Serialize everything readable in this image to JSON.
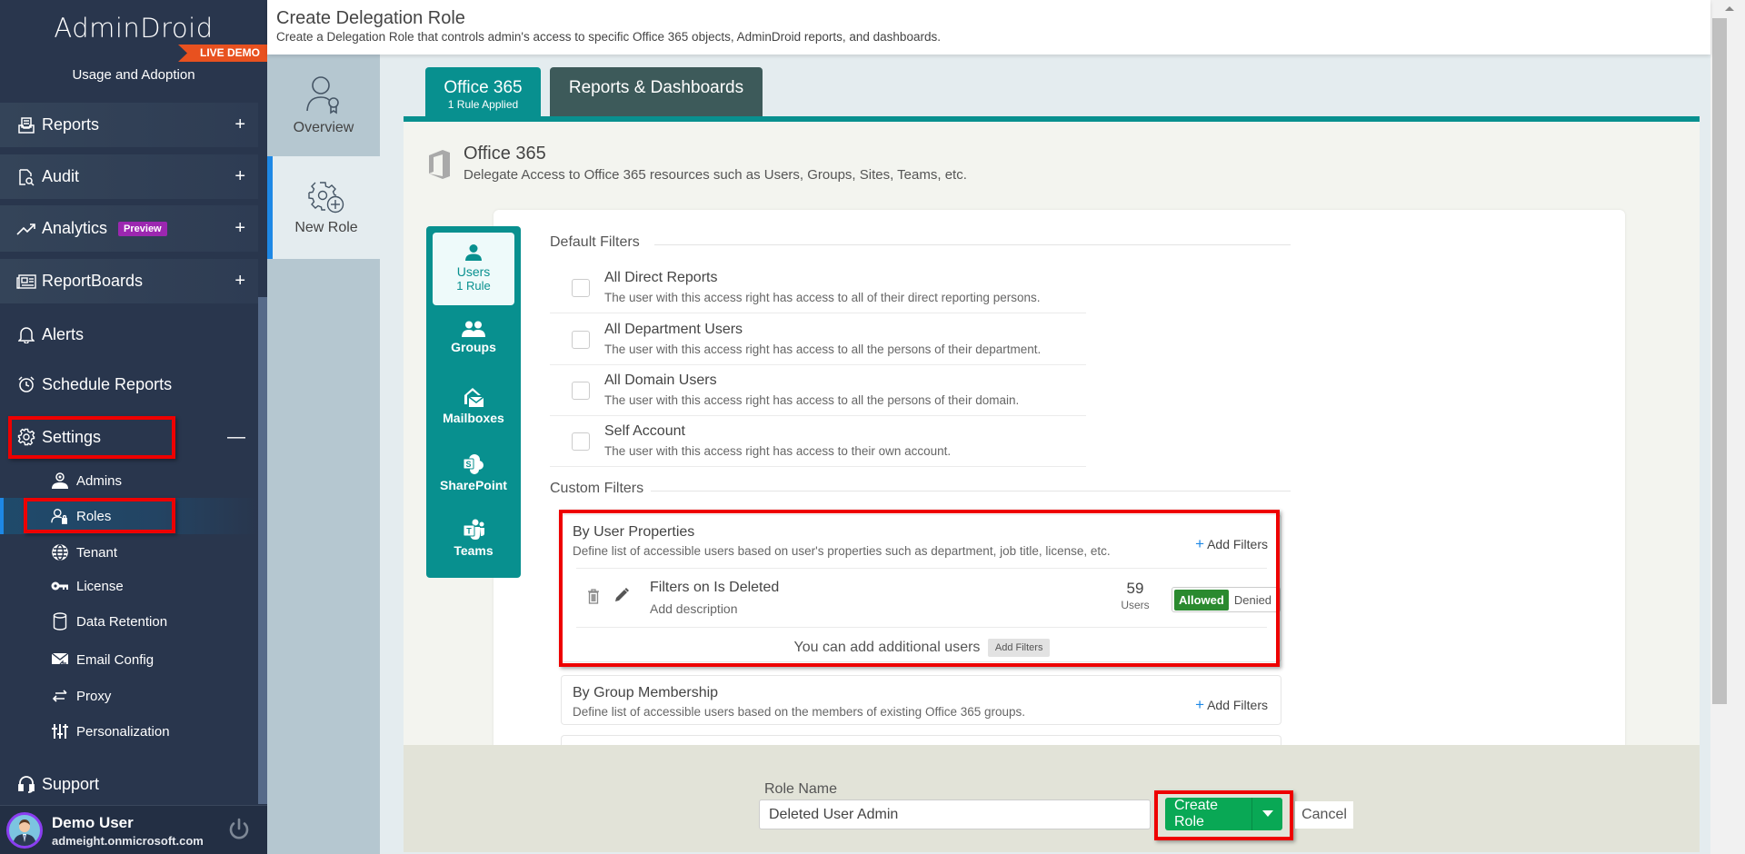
{
  "sidebar": {
    "logo": "AdminDroid",
    "badge": "LIVE DEMO",
    "edition": "Usage and Adoption",
    "groups": [
      {
        "label": "Reports",
        "icon": "reports-icon",
        "expander": "+"
      },
      {
        "label": "Audit",
        "icon": "audit-icon",
        "expander": "+"
      },
      {
        "label": "Analytics",
        "icon": "analytics-icon",
        "badge": "Preview",
        "expander": "+"
      },
      {
        "label": "ReportBoards",
        "icon": "reportboards-icon",
        "expander": "+"
      }
    ],
    "alerts": "Alerts",
    "schedule_reports": "Schedule Reports",
    "settings": {
      "label": "Settings",
      "expander": "—"
    },
    "settings_items": [
      {
        "label": "Admins",
        "icon": "admins-icon"
      },
      {
        "label": "Roles",
        "icon": "roles-icon",
        "active": true
      },
      {
        "label": "Tenant",
        "icon": "globe-icon"
      },
      {
        "label": "License",
        "icon": "key-icon"
      },
      {
        "label": "Data Retention",
        "icon": "database-icon"
      },
      {
        "label": "Email Config",
        "icon": "email-config-icon"
      },
      {
        "label": "Proxy",
        "icon": "proxy-icon"
      },
      {
        "label": "Personalization",
        "icon": "sliders-icon"
      }
    ],
    "support": "Support",
    "user": {
      "name": "Demo User",
      "email": "admeight.onmicrosoft.com"
    }
  },
  "header": {
    "title": "Create Delegation Role",
    "subtitle": "Create a Delegation Role that controls admin's access to specific Office 365 objects, AdminDroid reports, and dashboards."
  },
  "subnav": {
    "items": [
      {
        "label": "Overview"
      },
      {
        "label": "New Role",
        "active": true
      }
    ]
  },
  "tabs": [
    {
      "label": "Office 365",
      "sub": "1 Rule Applied",
      "active": true
    },
    {
      "label": "Reports & Dashboards"
    }
  ],
  "section": {
    "title": "Office 365",
    "description": "Delegate Access to Office 365 resources such as Users, Groups, Sites, Teams, etc."
  },
  "object_tabs": [
    {
      "label": "Users",
      "sub": "1 Rule",
      "active": true
    },
    {
      "label": "Groups"
    },
    {
      "label": "Mailboxes"
    },
    {
      "label": "SharePoint"
    },
    {
      "label": "Teams"
    }
  ],
  "default_filters": {
    "label": "Default Filters",
    "items": [
      {
        "title": "All Direct Reports",
        "description": "The user with this access right has access to all of their direct reporting persons.",
        "checked": false
      },
      {
        "title": "All Department Users",
        "description": "The user with this access right has access to all the persons of their department.",
        "checked": false
      },
      {
        "title": "All Domain Users",
        "description": "The user with this access right has access to all the persons of their domain.",
        "checked": false
      },
      {
        "title": "Self Account",
        "description": "The user with this access right has access to their own account.",
        "checked": false
      }
    ]
  },
  "custom_filters": {
    "label": "Custom Filters",
    "user_properties": {
      "title": "By User Properties",
      "description": "Define list of accessible users based on user's properties such as department, job title, license, etc.",
      "add_label": "Add Filters",
      "rule": {
        "title": "Filters on Is Deleted",
        "description": "Add description",
        "count": "59",
        "count_label": "Users",
        "allowed": "Allowed",
        "denied": "Denied",
        "state": "Allowed"
      },
      "add_more_text": "You can add additional users",
      "add_more_button": "Add Filters"
    },
    "group_membership": {
      "title": "By Group Membership",
      "description": "Define list of accessible users based on the members of existing Office 365 groups.",
      "add_label": "Add Filters"
    }
  },
  "footer": {
    "role_name_label": "Role Name",
    "role_name_value": "Deleted User Admin",
    "create_button": "Create Role",
    "cancel_button": "Cancel"
  },
  "colors": {
    "sidebar_bg": "#29364d",
    "accent_teal": "#08908f",
    "live_demo": "#e8511f",
    "preview_badge": "#9c27b0",
    "create_button": "#09a855",
    "allowed": "#2a8a2f",
    "highlight_box": "#ee0000"
  }
}
